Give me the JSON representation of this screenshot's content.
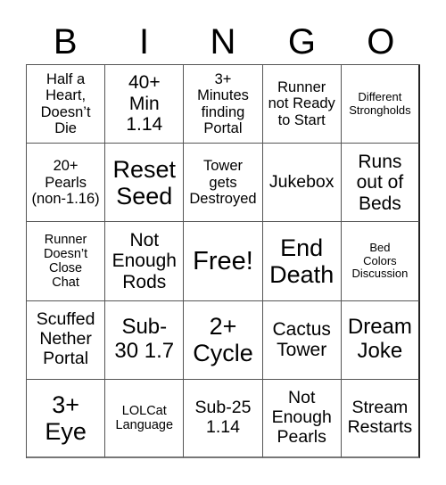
{
  "header": {
    "letters": [
      "B",
      "I",
      "N",
      "G",
      "O"
    ]
  },
  "board": {
    "rows": [
      [
        "Half a\nHeart,\nDoesn’t\nDie",
        "40+\nMin\n1.14",
        "3+\nMinutes\nfinding\nPortal",
        "Runner\nnot Ready\nto Start",
        "Different\nStrongholds"
      ],
      [
        "20+\nPearls\n(non-1.16)",
        "Reset\nSeed",
        "Tower\ngets\nDestroyed",
        "Jukebox",
        "Runs\nout of\nBeds"
      ],
      [
        "Runner\nDoesn’t\nClose\nChat",
        "Not\nEnough\nRods",
        "Free!",
        "End\nDeath",
        "Bed\nColors\nDiscussion"
      ],
      [
        "Scuffed\nNether\nPortal",
        "Sub-\n30 1.7",
        "2+\nCycle",
        "Cactus\nTower",
        "Dream\nJoke"
      ],
      [
        "3+\nEye",
        "LOLCat\nLanguage",
        "Sub-25\n1.14",
        "Not\nEnough\nPearls",
        "Stream\nRestarts"
      ]
    ]
  }
}
